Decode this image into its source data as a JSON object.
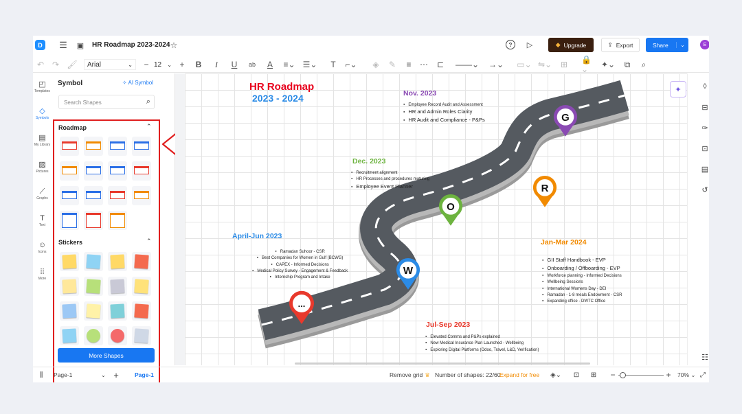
{
  "app": {
    "title": "HR Roadmap 2023-2024",
    "upgrade": "Upgrade",
    "export": "Export",
    "share": "Share",
    "avatar": "E"
  },
  "format": {
    "font": "Arial",
    "size": "12"
  },
  "rail": [
    {
      "label": "Templates",
      "icon": "templates-icon"
    },
    {
      "label": "Symbols",
      "icon": "symbols-icon"
    },
    {
      "label": "My Library",
      "icon": "library-icon"
    },
    {
      "label": "Pictures",
      "icon": "pictures-icon"
    },
    {
      "label": "Graphs",
      "icon": "graphs-icon"
    },
    {
      "label": "Text",
      "icon": "text-icon"
    },
    {
      "label": "Icons",
      "icon": "icons-icon"
    },
    {
      "label": "More",
      "icon": "more-icon"
    }
  ],
  "panel": {
    "title": "Symbol",
    "ai": "AI Symbol",
    "search_placeholder": "Search Shapes",
    "roadmap": "Roadmap",
    "stickers": "Stickers",
    "more_shapes": "More Shapes"
  },
  "canvas": {
    "title1": "HR Roadmap",
    "title2": "2023 - 2024",
    "nov": {
      "head": "Nov. 2023",
      "items": [
        "Employee Record Audit and Assessment",
        "HR and Admin Roles Clarity",
        "HR Audit and Compliance - P&Ps"
      ]
    },
    "dec": {
      "head": "Dec. 2023",
      "items": [
        "Recruitment alignment",
        "HR Processes and procedures maturing",
        "Employee Event Planner"
      ]
    },
    "apr": {
      "head": "April-Jun 2023",
      "items": [
        "Ramadan Suhoor - CSR",
        "Best Companies for Women in Gulf (BCWG)",
        "CAPEX - Informed Decisions",
        "Medical Policy Survey - Engagement & Feedback",
        "Internship Program and Intake"
      ]
    },
    "jan": {
      "head": "Jan-Mar 2024",
      "items": [
        "GII Staff Handbook - EVP",
        "Onboarding / Offboarding - EVP",
        "Workforce planning - Informed Decisions",
        "Wellbeing Sessions",
        "International Womens Day - DEI",
        "Ramadan - 1-8 meals Endowment - CSR",
        "Expanding office - DWTC Office"
      ]
    },
    "jul": {
      "head": "Jul-Sep 2023",
      "items": [
        "Elevated Comms and P&Ps explained",
        "New Medical Insurance Plan Launched - Wellbeing",
        "Exploring Digital Platforms (Odoo, Travel, L&D, Verification)"
      ]
    },
    "pins": {
      "g": "G",
      "r": "R",
      "o": "O",
      "w": "W",
      "dots": "..."
    },
    "colors": {
      "red": "#e8392c",
      "blue": "#2b8be6",
      "purple": "#8a4ab3",
      "green": "#6db33f",
      "orange": "#f18a00",
      "road": "#555a60"
    }
  },
  "status": {
    "page_select": "Page-1",
    "page_tab": "Page-1",
    "remove_grid": "Remove grid",
    "shapes": "Number of shapes: 22/60",
    "expand": "Expand for free",
    "zoom": "70%"
  }
}
